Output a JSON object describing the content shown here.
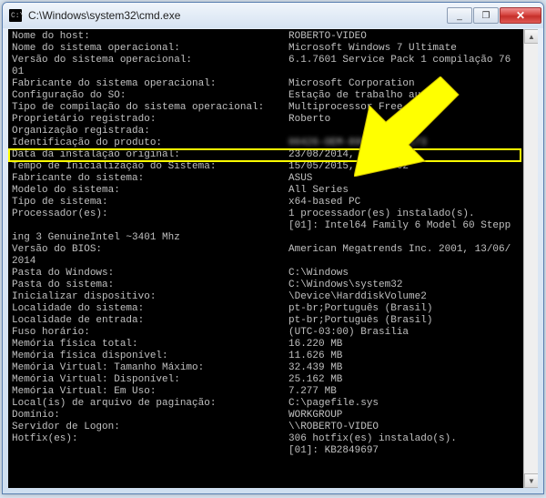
{
  "window": {
    "title": "C:\\Windows\\system32\\cmd.exe",
    "win_min": "_",
    "win_max": "❐",
    "win_close": "✕",
    "scroll_up": "▲",
    "scroll_down": "▼"
  },
  "rows": [
    {
      "label": "Nome do host:",
      "value": "ROBERTO-VIDEO"
    },
    {
      "label": "Nome do sistema operacional:",
      "value": "Microsoft Windows 7 Ultimate"
    },
    {
      "label": "Versão do sistema operacional:",
      "value": "6.1.7601 Service Pack 1 compilação 76"
    },
    {
      "label": "01",
      "value": ""
    },
    {
      "label": "Fabricante do sistema operacional:",
      "value": "Microsoft Corporation"
    },
    {
      "label": "Configuração do SO:",
      "value": "Estação de trabalho autônoma"
    },
    {
      "label": "Tipo de compilação do sistema operacional:",
      "value": "Multiprocessor Free"
    },
    {
      "label": "Proprietário registrado:",
      "value": "Roberto"
    },
    {
      "label": "Organização registrada:",
      "value": ""
    },
    {
      "label": "Identificação do produto:",
      "value": "00426-OEM-8992662-00173",
      "blur": true
    },
    {
      "label": "Data da instalação original:",
      "value": "23/08/2014, 17:27:51",
      "hl": true
    },
    {
      "label": "Tempo de Inicialização do Sistema:",
      "value": "15/05/2015, 13:40:02"
    },
    {
      "label": "Fabricante do sistema:",
      "value": "ASUS"
    },
    {
      "label": "Modelo do sistema:",
      "value": "All Series"
    },
    {
      "label": "Tipo de sistema:",
      "value": "x64-based PC"
    },
    {
      "label": "Processador(es):",
      "value": "1 processador(es) instalado(s)."
    },
    {
      "label": "",
      "value": "[01]: Intel64 Family 6 Model 60 Stepp"
    },
    {
      "label": "ing 3 GenuineIntel ~3401 Mhz",
      "value": ""
    },
    {
      "label": "Versão do BIOS:",
      "value": "American Megatrends Inc. 2001, 13/06/"
    },
    {
      "label": "2014",
      "value": ""
    },
    {
      "label": "Pasta do Windows:",
      "value": "C:\\Windows"
    },
    {
      "label": "Pasta do sistema:",
      "value": "C:\\Windows\\system32"
    },
    {
      "label": "Inicializar dispositivo:",
      "value": "\\Device\\HarddiskVolume2"
    },
    {
      "label": "Localidade do sistema:",
      "value": "pt-br;Português (Brasil)"
    },
    {
      "label": "Localidade de entrada:",
      "value": "pt-br;Português (Brasil)"
    },
    {
      "label": "Fuso horário:",
      "value": "(UTC-03:00) Brasília"
    },
    {
      "label": "Memória física total:",
      "value": "16.220 MB"
    },
    {
      "label": "Memória física disponível:",
      "value": "11.626 MB"
    },
    {
      "label": "Memória Virtual: Tamanho Máximo:",
      "value": "32.439 MB"
    },
    {
      "label": "Memória Virtual: Disponível:",
      "value": "25.162 MB"
    },
    {
      "label": "Memória Virtual: Em Uso:",
      "value": "7.277 MB"
    },
    {
      "label": "Local(is) de arquivo de paginação:",
      "value": "C:\\pagefile.sys"
    },
    {
      "label": "Domínio:",
      "value": "WORKGROUP"
    },
    {
      "label": "Servidor de Logon:",
      "value": "\\\\ROBERTO-VIDEO"
    },
    {
      "label": "Hotfix(es):",
      "value": "306 hotfix(es) instalado(s)."
    },
    {
      "label": "",
      "value": "[01]: KB2849697"
    }
  ],
  "annotations": {
    "highlight_row_index": 10,
    "arrow_color": "#ffff00"
  }
}
